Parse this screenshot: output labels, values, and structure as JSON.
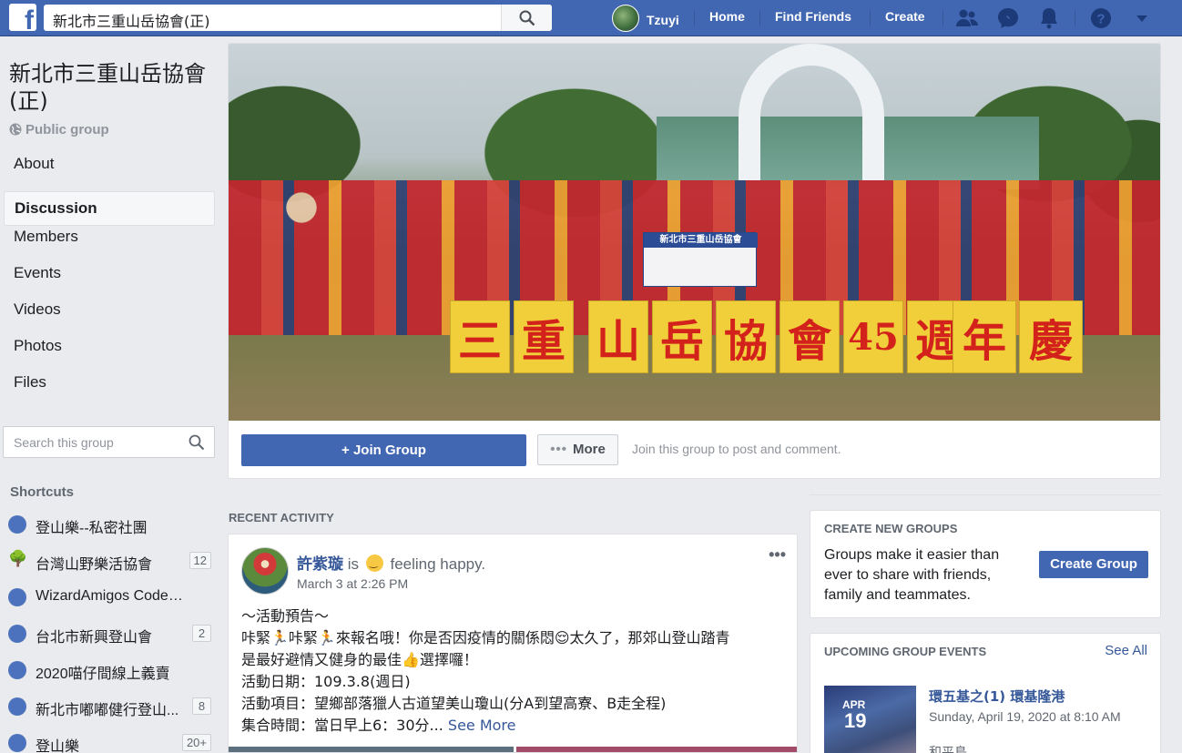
{
  "topbar": {
    "logo": "f",
    "search_value": "新北市三重山岳協會(正)",
    "user_name": "Tzuyi",
    "home": "Home",
    "find_friends": "Find Friends",
    "create": "Create",
    "icons": [
      "search-icon",
      "friend-requests-icon",
      "messenger-icon",
      "notifications-icon",
      "help-icon",
      "dropdown-arrow-icon"
    ],
    "brand_color": "#4267b2"
  },
  "group": {
    "title": "新北市三重山岳協會(正)",
    "privacy": "Public group",
    "nav": [
      "About",
      "Discussion",
      "Members",
      "Events",
      "Videos",
      "Photos",
      "Files"
    ],
    "active_nav": "Discussion",
    "search_placeholder": "Search this group"
  },
  "shortcuts": {
    "heading": "Shortcuts",
    "items": [
      {
        "label": "登山樂--私密社團",
        "count": "",
        "icon": "group-icon"
      },
      {
        "label": "台灣山野樂活協會",
        "count": "12",
        "icon": "tree-icon"
      },
      {
        "label": "WizardAmigos CodeCa...",
        "count": "",
        "icon": "group-icon"
      },
      {
        "label": "台北市新興登山會",
        "count": "2",
        "icon": "group-icon"
      },
      {
        "label": "2020喵仔間線上義賣",
        "count": "",
        "icon": "group-icon"
      },
      {
        "label": "新北市嘟嘟健行登山...",
        "count": "8",
        "icon": "group-icon"
      },
      {
        "label": "登山樂",
        "count": "20+",
        "icon": "group-icon"
      }
    ]
  },
  "cover": {
    "banner_chars": [
      "三",
      "重",
      "山",
      "岳",
      "協",
      "會",
      "45",
      "週",
      "年",
      "慶"
    ],
    "flag_text": "新北市三重山岳協會",
    "join_button": "Join Group",
    "more_button": "More",
    "join_hint": "Join this group to post and comment."
  },
  "recent": {
    "heading": "RECENT ACTIVITY",
    "post": {
      "author": "許紫璇",
      "feeling_prefix": "is",
      "feeling": "feeling happy.",
      "time": "March 3 at 2:26 PM",
      "lines": [
        "～活動預告～",
        "咔緊🏃咔緊🏃來報名哦！你是否因疫情的關係悶😌太久了，那郊山登山踏青",
        "是最好避情又健身的最佳👍選擇囉！",
        "活動日期：109.3.8(週日)",
        "活動項目：望鄉部落獵人古道望美山瓊山(分A到望高寮、B走全程)",
        "集合時間：當日早上6：30分..."
      ],
      "see_more": "See More"
    }
  },
  "create_groups": {
    "heading": "CREATE NEW GROUPS",
    "text": "Groups make it easier than ever to share with friends, family and teammates.",
    "button": "Create Group"
  },
  "events": {
    "heading": "UPCOMING GROUP EVENTS",
    "see_all": "See All",
    "month": "APR",
    "day": "19",
    "title": "環五基之(1) 環基隆港",
    "date": "Sunday, April 19, 2020 at 8:10 AM",
    "place": "和平島"
  }
}
